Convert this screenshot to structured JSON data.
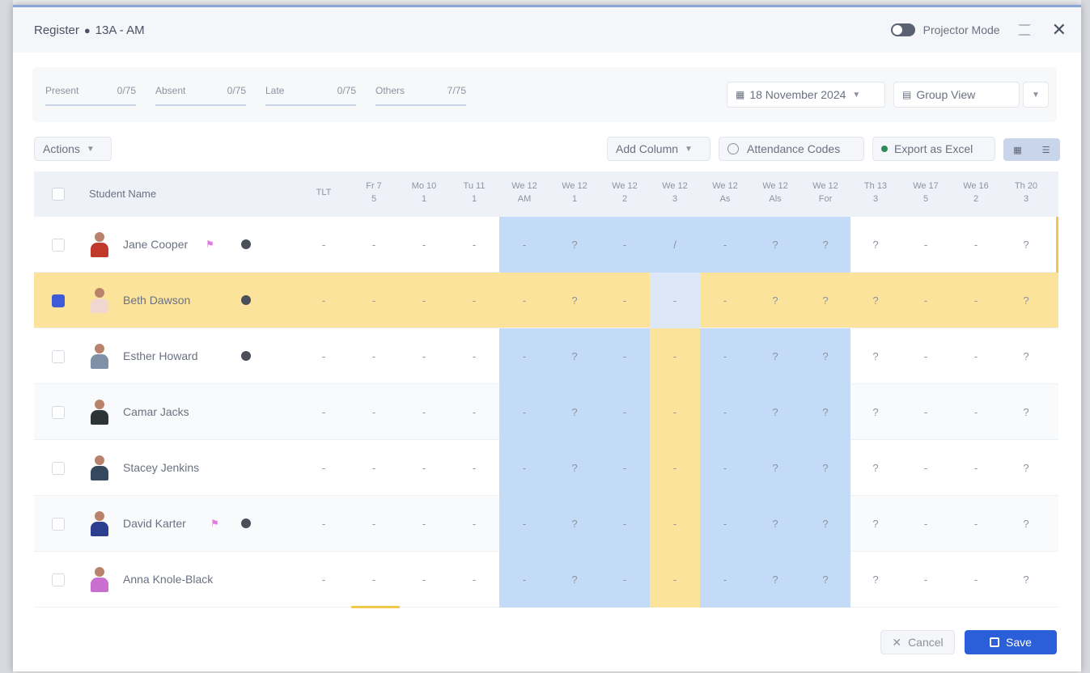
{
  "window": {
    "title": "Register",
    "location_icon": "pin-icon",
    "group": "13A - AM",
    "projector_label": "Projector Mode"
  },
  "summary": {
    "stats": [
      {
        "label": "Present",
        "value": "0/75"
      },
      {
        "label": "Absent",
        "value": "0/75"
      },
      {
        "label": "Late",
        "value": "0/75"
      },
      {
        "label": "Others",
        "value": "7/75"
      }
    ],
    "date": "18 November 2024",
    "group_view": "Group View"
  },
  "toolbar": {
    "actions": "Actions",
    "add_column": "Add Column",
    "attendance_codes": "Attendance Codes",
    "export_excel": "Export as Excel"
  },
  "table": {
    "name_header": "Student Name",
    "columns": [
      {
        "l1": "TLT",
        "l2": ""
      },
      {
        "l1": "Fr 7",
        "l2": "5"
      },
      {
        "l1": "Mo 10",
        "l2": "1"
      },
      {
        "l1": "Tu 11",
        "l2": "1"
      },
      {
        "l1": "We 12",
        "l2": "AM"
      },
      {
        "l1": "We 12",
        "l2": "1"
      },
      {
        "l1": "We 12",
        "l2": "2"
      },
      {
        "l1": "We 12",
        "l2": "3"
      },
      {
        "l1": "We 12",
        "l2": "As"
      },
      {
        "l1": "We 12",
        "l2": "Als"
      },
      {
        "l1": "We 12",
        "l2": "For"
      },
      {
        "l1": "Th 13",
        "l2": "3"
      },
      {
        "l1": "We 17",
        "l2": "5"
      },
      {
        "l1": "We 16",
        "l2": "2"
      },
      {
        "l1": "Th 20",
        "l2": "3"
      }
    ],
    "rows": [
      {
        "name": "Jane Cooper",
        "flag": true,
        "dot": true,
        "selected": false,
        "marks": [
          "-",
          "-",
          "-",
          "-",
          "-",
          "?",
          "-",
          "/",
          "-",
          "?",
          "?",
          "?",
          "-",
          "-",
          "?"
        ]
      },
      {
        "name": "Beth Dawson",
        "flag": false,
        "dot": true,
        "selected": true,
        "marks": [
          "-",
          "-",
          "-",
          "-",
          "-",
          "?",
          "-",
          "-",
          "-",
          "?",
          "?",
          "?",
          "-",
          "-",
          "?"
        ]
      },
      {
        "name": "Esther Howard",
        "flag": false,
        "dot": true,
        "selected": false,
        "marks": [
          "-",
          "-",
          "-",
          "-",
          "-",
          "?",
          "-",
          "-",
          "-",
          "?",
          "?",
          "?",
          "-",
          "-",
          "?"
        ]
      },
      {
        "name": "Camar Jacks",
        "flag": false,
        "dot": false,
        "selected": false,
        "marks": [
          "-",
          "-",
          "-",
          "-",
          "-",
          "?",
          "-",
          "-",
          "-",
          "?",
          "?",
          "?",
          "-",
          "-",
          "?"
        ]
      },
      {
        "name": "Stacey Jenkins",
        "flag": false,
        "dot": false,
        "selected": false,
        "marks": [
          "-",
          "-",
          "-",
          "-",
          "-",
          "?",
          "-",
          "-",
          "-",
          "?",
          "?",
          "?",
          "-",
          "-",
          "?"
        ]
      },
      {
        "name": "David Karter",
        "flag": true,
        "dot": true,
        "selected": false,
        "marks": [
          "-",
          "-",
          "-",
          "-",
          "-",
          "?",
          "-",
          "-",
          "-",
          "?",
          "?",
          "?",
          "-",
          "-",
          "?"
        ]
      },
      {
        "name": "Anna Knole-Black",
        "flag": false,
        "dot": false,
        "selected": false,
        "marks": [
          "-",
          "-",
          "-",
          "-",
          "-",
          "?",
          "-",
          "-",
          "-",
          "?",
          "?",
          "?",
          "-",
          "-",
          "?"
        ]
      }
    ]
  },
  "footer": {
    "cancel": "Cancel",
    "save": "Save"
  },
  "colors": {
    "accent": "#2b5fd9",
    "highlight_blue": "#c3dbf6",
    "highlight_yellow": "#fbe39c",
    "checkbox_on": "#3d5bd9"
  }
}
